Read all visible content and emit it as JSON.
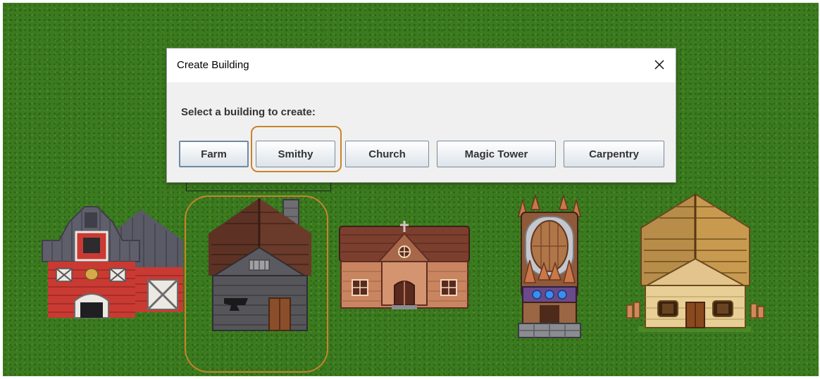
{
  "dialog": {
    "title": "Create Building",
    "prompt": "Select a building to create:",
    "buttons": [
      {
        "label": "Farm"
      },
      {
        "label": "Smithy"
      },
      {
        "label": "Church"
      },
      {
        "label": "Magic Tower"
      },
      {
        "label": "Carpentry"
      }
    ],
    "focused_button": "Farm",
    "highlighted_button": "Smithy"
  },
  "buildings": [
    "barn",
    "smithy",
    "church",
    "magic-tower",
    "carpentry"
  ],
  "icons": {
    "close": "close-icon"
  },
  "colors": {
    "grass": "#3b7a1f",
    "highlight": "#c9832b",
    "dialog_bg": "#f0f0f0",
    "barn_red": "#c93a33",
    "roof_gray": "#5e5f6b"
  }
}
